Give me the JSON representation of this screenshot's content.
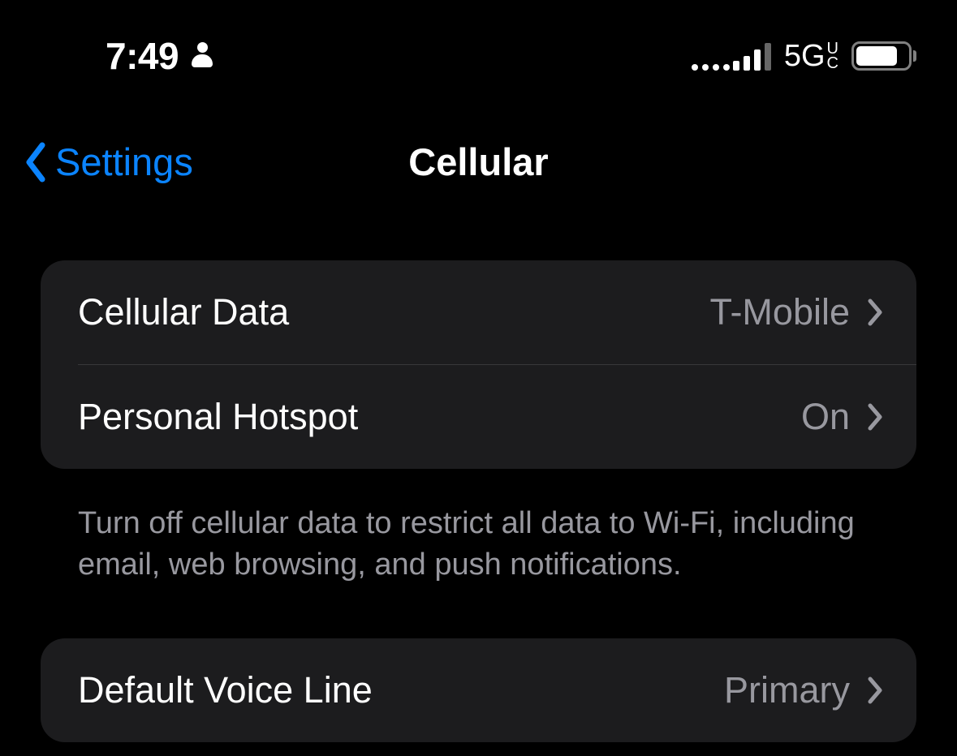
{
  "statusBar": {
    "time": "7:49",
    "network": "5G",
    "networkSubTop": "U",
    "networkSubBottom": "C"
  },
  "nav": {
    "back": "Settings",
    "title": "Cellular"
  },
  "groups": [
    {
      "rows": [
        {
          "label": "Cellular Data",
          "value": "T-Mobile"
        },
        {
          "label": "Personal Hotspot",
          "value": "On"
        }
      ],
      "footer": "Turn off cellular data to restrict all data to Wi-Fi, including email, web browsing, and push notifications."
    },
    {
      "rows": [
        {
          "label": "Default Voice Line",
          "value": "Primary"
        }
      ]
    }
  ]
}
